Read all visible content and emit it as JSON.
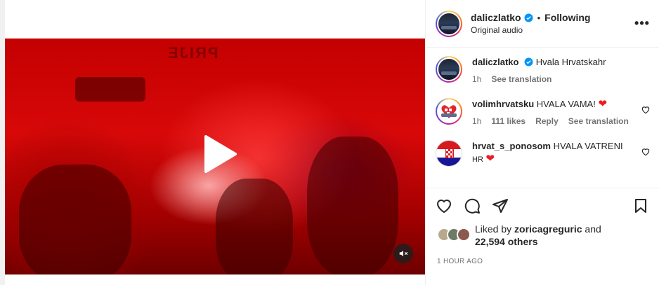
{
  "post": {
    "author": "daliczlatko",
    "separator": "•",
    "follow_status": "Following",
    "audio": "Original audio"
  },
  "media": {
    "banner_text": "PRIJE"
  },
  "comments": [
    {
      "username": "daliczlatko",
      "verified": true,
      "text": "Hvala Hrvatskahr",
      "time": "1h",
      "likes": "",
      "reply": "",
      "translate": "See translation"
    },
    {
      "username": "volimhrvatsku",
      "verified": false,
      "text": "HVALA VAMA!",
      "time": "1h",
      "likes": "111 likes",
      "reply": "Reply",
      "translate": "See translation"
    },
    {
      "username": "hrvat_s_ponosom",
      "verified": false,
      "text": "HVALA VATRENI",
      "text2": "HR"
    }
  ],
  "likes": {
    "prefix": "Liked by",
    "user": "zoricagreguric",
    "and": "and",
    "others": "22,594 others"
  },
  "timestamp": "1 hour ago",
  "colors": {
    "verified_blue": "#0095f6",
    "heart_red": "#ed1c24",
    "text_secondary": "#737373"
  },
  "icons": [
    "play-icon",
    "mute-icon",
    "verified-icon",
    "more-icon",
    "heart-icon",
    "comment-icon",
    "share-icon",
    "bookmark-icon"
  ]
}
